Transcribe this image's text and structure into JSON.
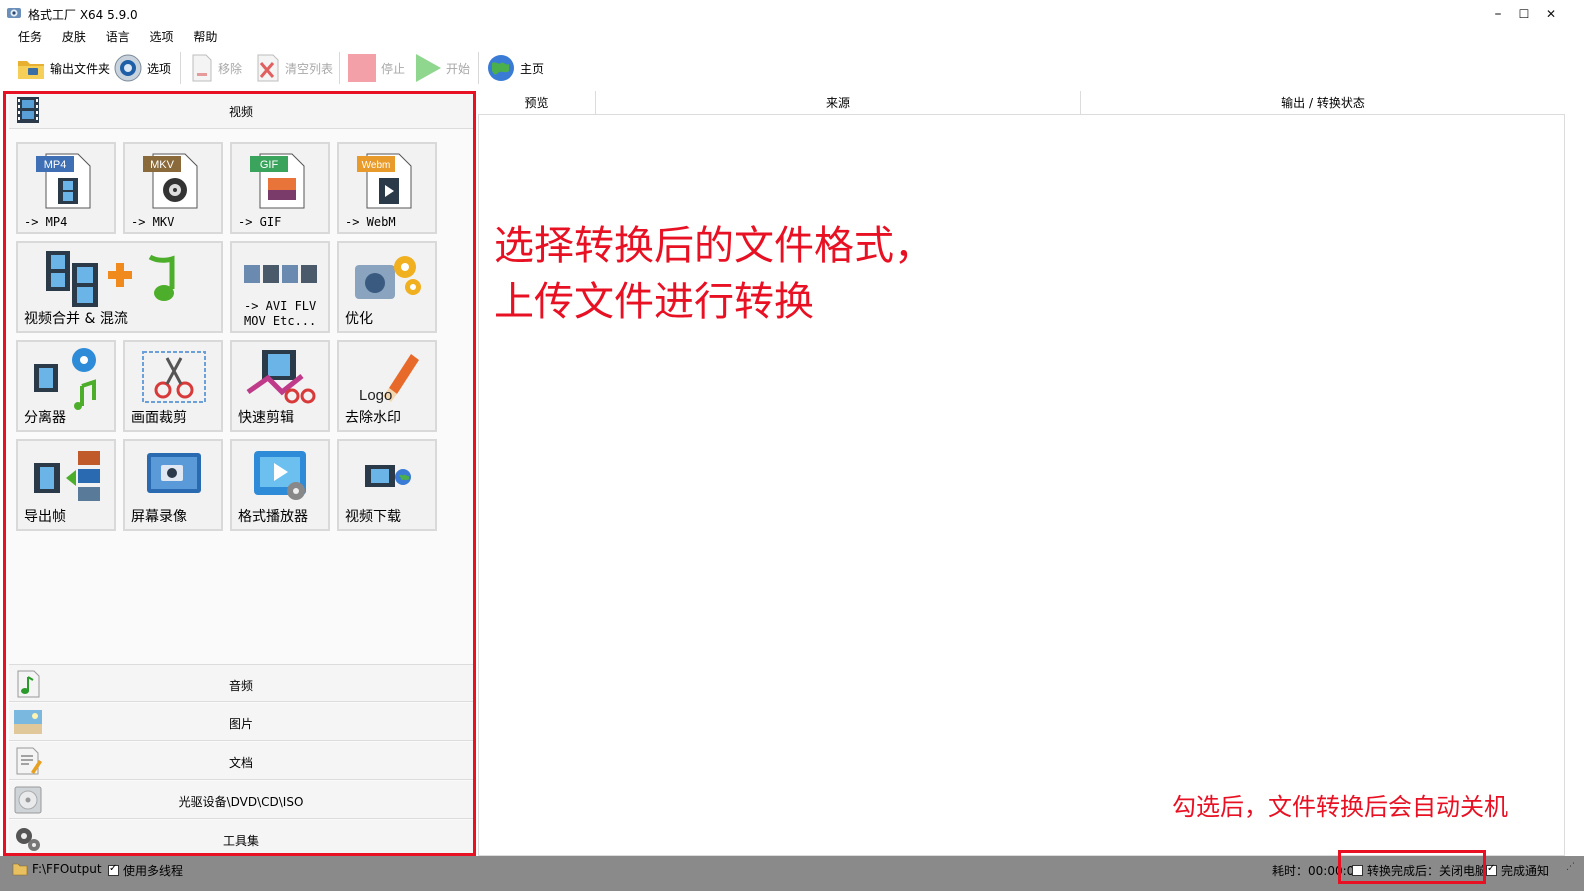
{
  "window": {
    "title": "格式工厂 X64 5.9.0",
    "minimize": "–",
    "maximize": "☐",
    "close": "✕"
  },
  "menu": [
    "任务",
    "皮肤",
    "语言",
    "选项",
    "帮助"
  ],
  "toolbar": {
    "output_folder": "输出文件夹",
    "options": "选项",
    "remove": "移除",
    "clear_list": "清空列表",
    "stop": "停止",
    "start": "开始",
    "home": "主页"
  },
  "categories": {
    "video": "视频",
    "audio": "音频",
    "image": "图片",
    "document": "文档",
    "disc": "光驱设备\\DVD\\CD\\ISO",
    "tools": "工具集"
  },
  "video_tiles": {
    "mp4": {
      "badge": "MP4",
      "label": "-> MP4"
    },
    "mkv": {
      "badge": "MKV",
      "label": "-> MKV"
    },
    "gif": {
      "badge": "GIF",
      "label": "-> GIF"
    },
    "webm": {
      "badge": "Webm",
      "label": "-> WebM"
    },
    "merge": {
      "label": "视频合并 & 混流"
    },
    "other_formats": {
      "label": "-> AVI FLV\nMOV Etc..."
    },
    "optimize": {
      "label": "优化"
    },
    "splitter": {
      "label": "分离器"
    },
    "crop": {
      "label": "画面裁剪"
    },
    "quick_cut": {
      "label": "快速剪辑"
    },
    "remove_watermark": {
      "label": "去除水印",
      "logo_text": "Logo"
    },
    "export_frames": {
      "label": "导出帧"
    },
    "screen_record": {
      "label": "屏幕录像"
    },
    "player": {
      "label": "格式播放器"
    },
    "download": {
      "label": "视频下载"
    }
  },
  "table": {
    "columns": [
      "预览",
      "来源",
      "输出 / 转换状态"
    ]
  },
  "annotations": {
    "main_line1": "选择转换后的文件格式，",
    "main_line2": "上传文件进行转换",
    "shutdown_note": "勾选后，文件转换后会自动关机"
  },
  "status": {
    "output_path": "F:\\FFOutput",
    "multithread_label": "使用多线程",
    "multithread_checked": true,
    "elapsed": "耗时：00:00:00",
    "shutdown_label": "转换完成后：关闭电脑",
    "shutdown_checked": false,
    "notify_label": "完成通知",
    "notify_checked": true
  },
  "colors": {
    "accent_red": "#e81123",
    "status_bg": "#8a8a8a"
  }
}
